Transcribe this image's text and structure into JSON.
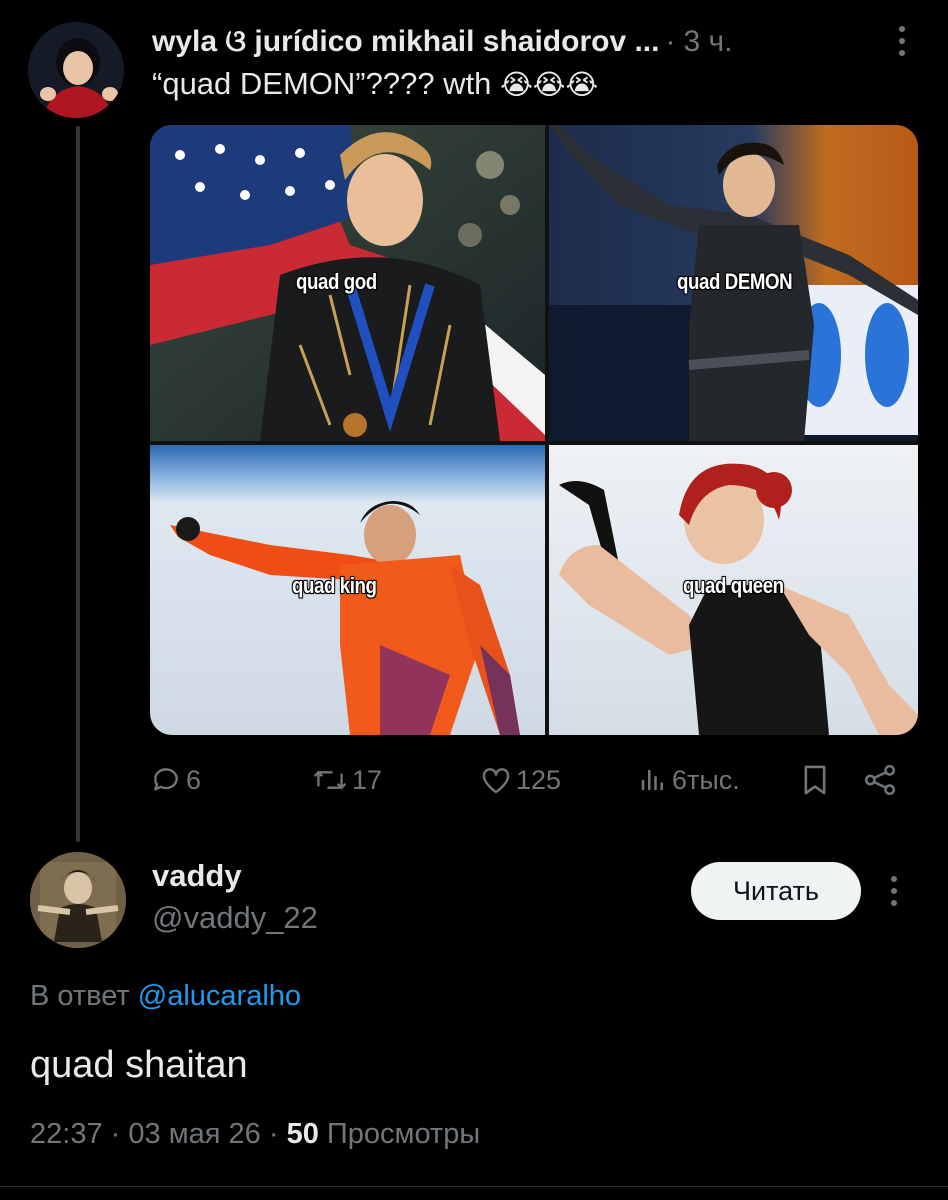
{
  "parent_tweet": {
    "author_name": "wyla ଓ jurídico mikhail shaidorov ...",
    "separator": "·",
    "time": "3 ч.",
    "text": "“quad DEMON”???? wth",
    "emojis": "😭😭😭",
    "media": {
      "captions": {
        "top_left": "quad god",
        "top_right": "quad DEMON",
        "bottom_left": "quad king",
        "bottom_right": "quad queen"
      }
    },
    "actions": {
      "replies": "6",
      "reposts": "17",
      "likes": "125",
      "views": "6тыс."
    },
    "icons": [
      "more-vertical-icon",
      "reply-icon",
      "repost-icon",
      "like-icon",
      "views-icon",
      "bookmark-icon",
      "share-icon"
    ]
  },
  "reply_tweet": {
    "author_name": "vaddy",
    "handle": "@vaddy_22",
    "follow_label": "Читать",
    "reply_to_prefix": "В ответ",
    "reply_to_handle": "@alucaralho",
    "text": "quad shaitan",
    "time": "22:37",
    "date": "03 мая 26",
    "separator": "·",
    "views_count": "50",
    "views_label": "Просмотры"
  },
  "colors": {
    "background": "#000000",
    "text_primary": "#e7e9ea",
    "text_secondary": "#71767b",
    "link": "#1d9bf0",
    "button_bg": "#eff3f4"
  }
}
